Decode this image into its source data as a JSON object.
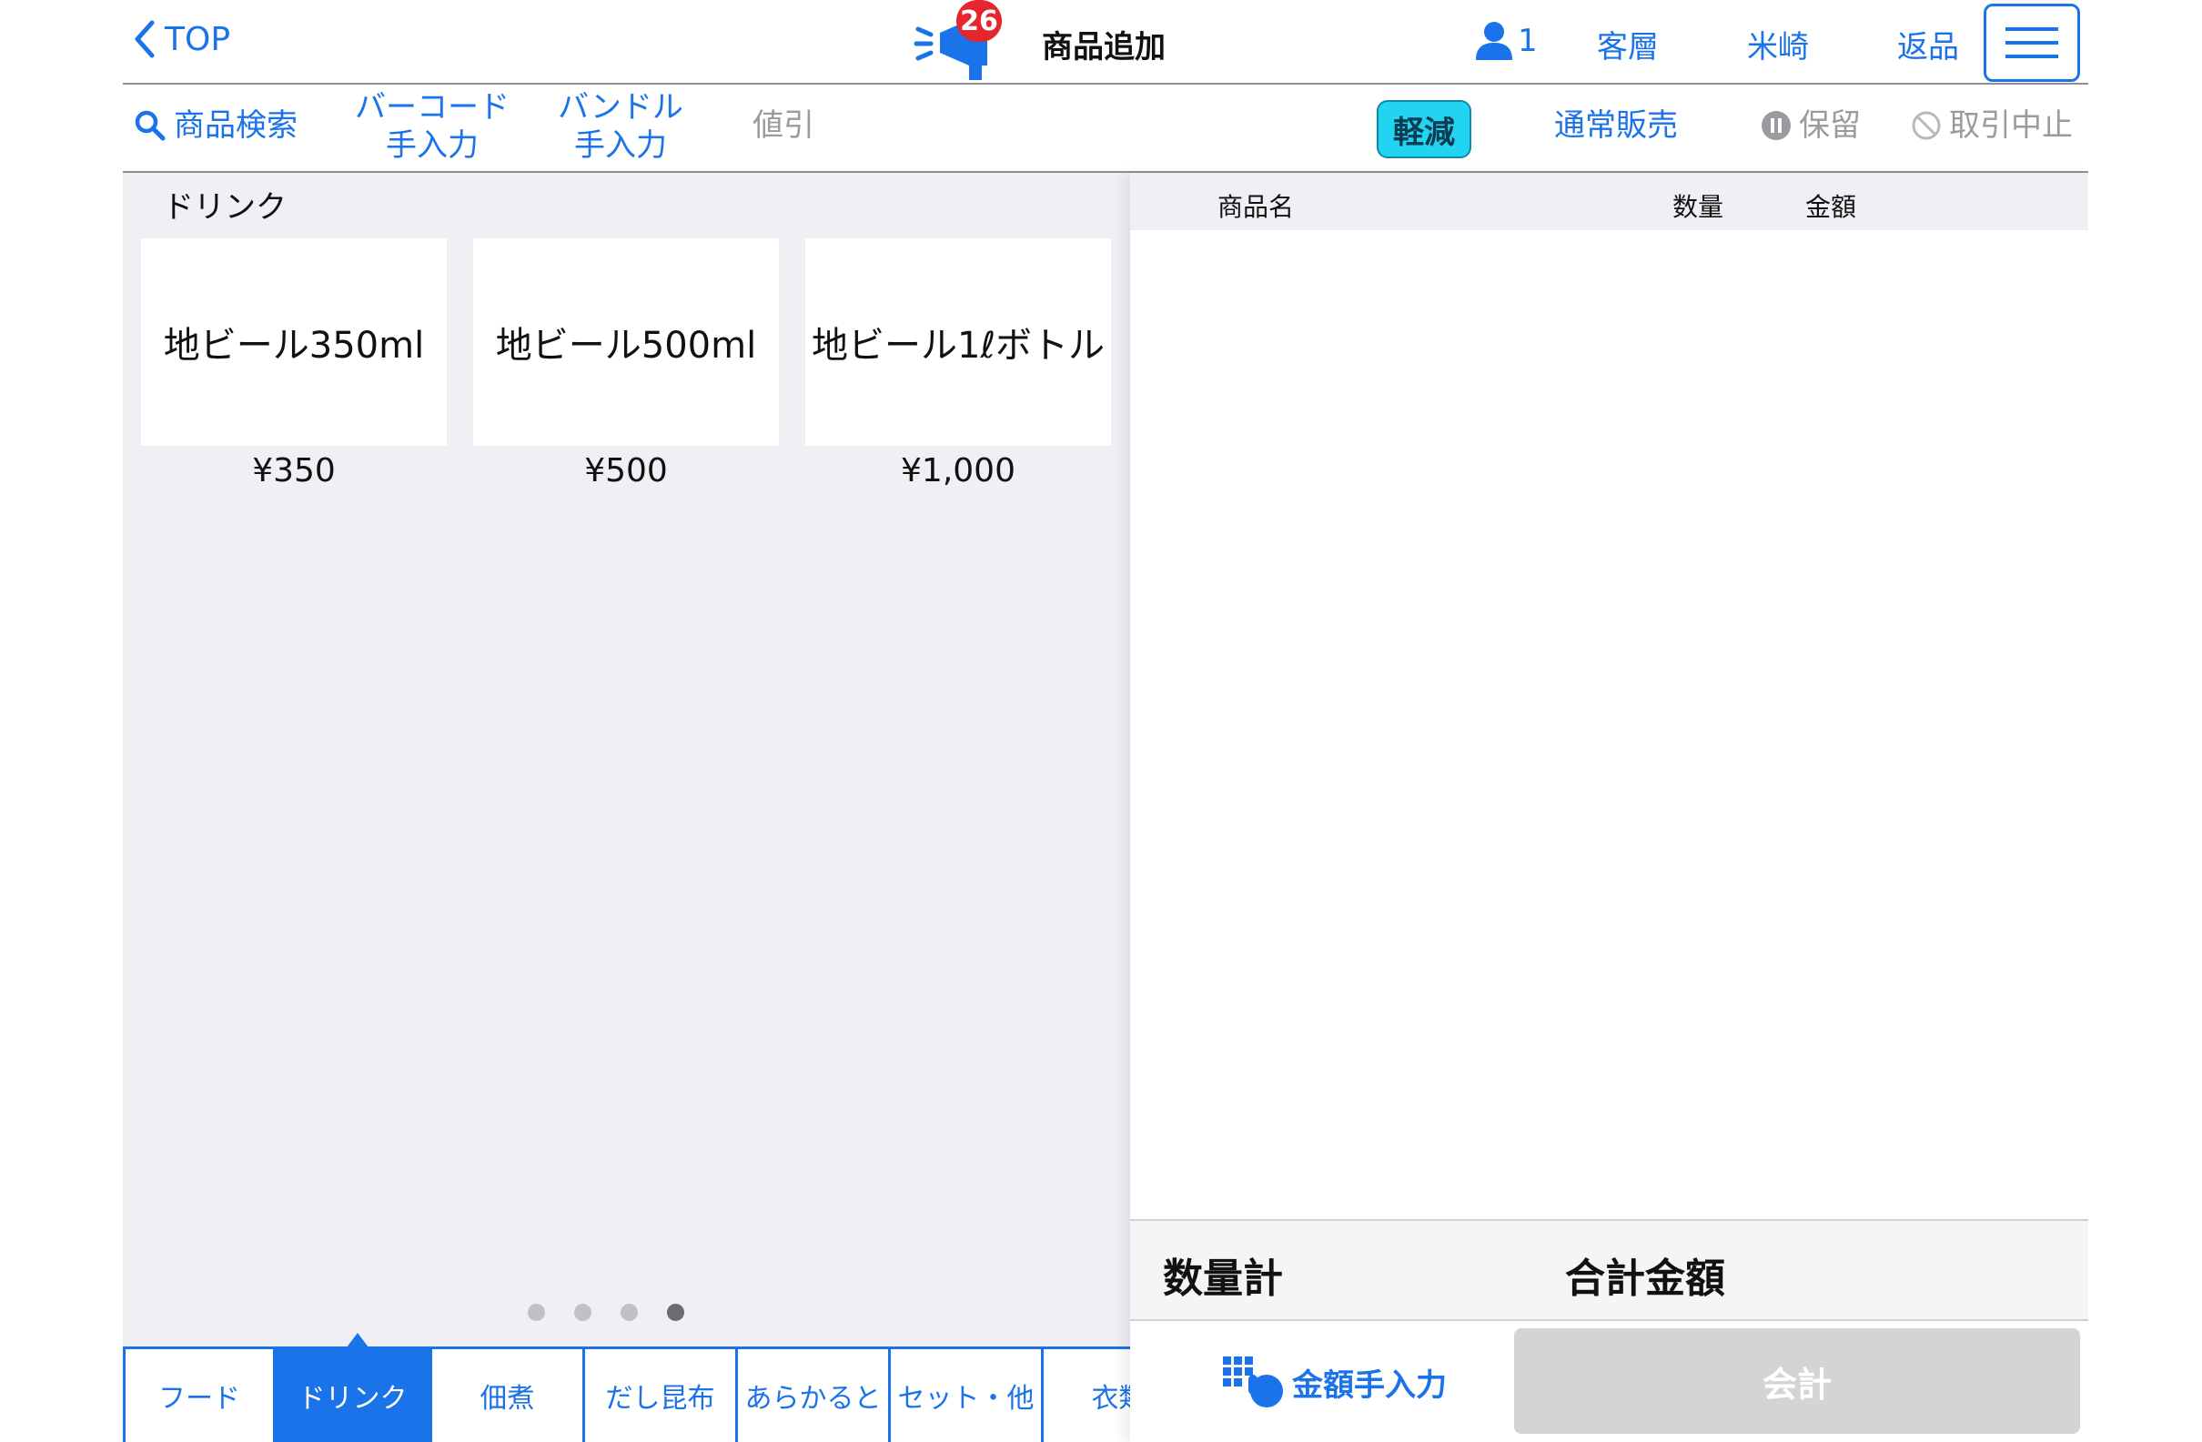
{
  "header": {
    "back_label": "TOP",
    "notification_count": "26",
    "title": "商品追加",
    "customer_count": "1",
    "links": [
      "客層",
      "米崎",
      "返品"
    ]
  },
  "toolbar": {
    "search_label": "商品検索",
    "barcode_line1": "バーコード",
    "barcode_line2": "手入力",
    "bundle_line1": "バンドル",
    "bundle_line2": "手入力",
    "discount_label": "値引",
    "reduced_label": "軽減",
    "normal_sale_label": "通常販売",
    "hold_label": "保留",
    "cancel_label": "取引中止"
  },
  "products": {
    "category_title": "ドリンク",
    "items": [
      {
        "name": "地ビール350ml",
        "price": "¥350"
      },
      {
        "name": "地ビール500ml",
        "price": "¥500"
      },
      {
        "name": "地ビール1ℓボトル",
        "price": "¥1,000"
      }
    ],
    "page_count": 4,
    "current_page": 4
  },
  "tabs": [
    "フード",
    "ドリンク",
    "佃煮",
    "だし昆布",
    "あらかると",
    "セット・他",
    "衣類"
  ],
  "active_tab": "ドリンク",
  "cart": {
    "columns": {
      "name": "商品名",
      "quantity": "数量",
      "amount": "金額"
    },
    "quantity_total_label": "数量計",
    "total_amount_label": "合計金額",
    "manual_amount_label": "金額手入力",
    "checkout_label": "会計"
  },
  "colors": {
    "accent": "#1a73e8",
    "reduced_button": "#22d3f2",
    "badge": "#e5262f",
    "panel_background": "#efeff4",
    "checkout_disabled": "#d4d4d6"
  }
}
